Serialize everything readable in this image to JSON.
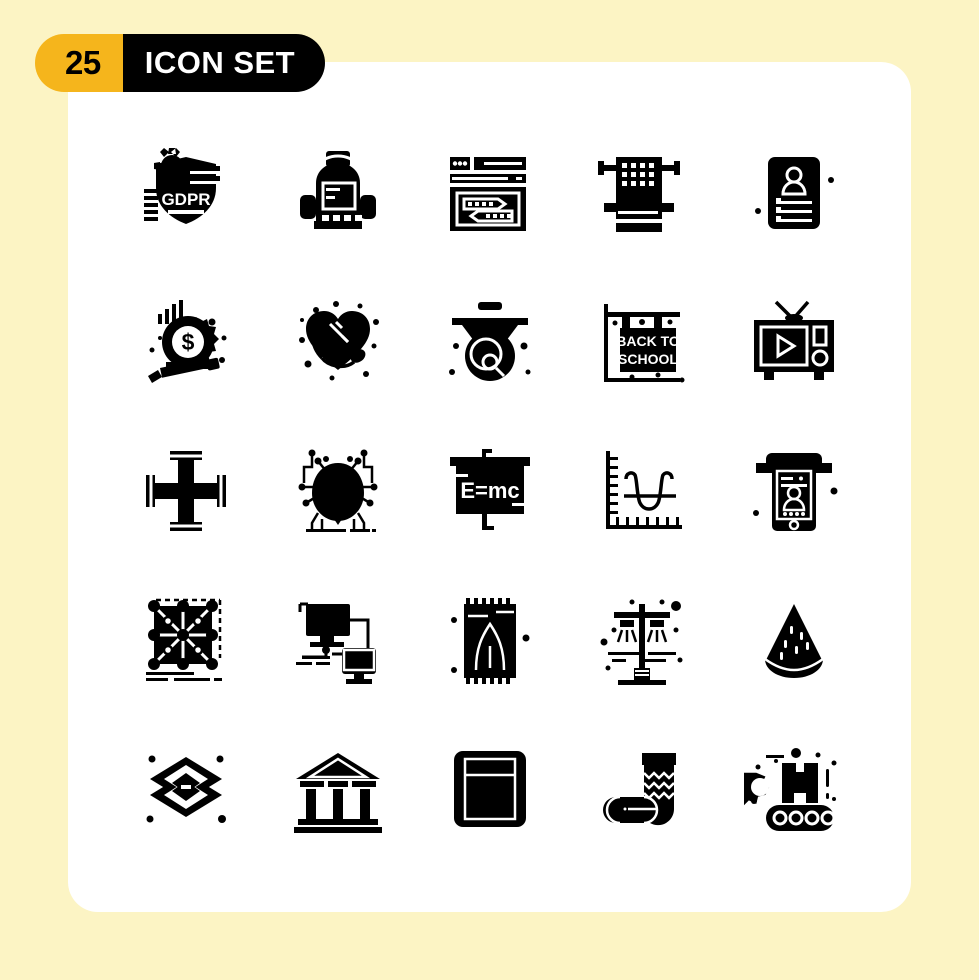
{
  "header": {
    "count": "25",
    "title": "ICON SET"
  },
  "colors": {
    "background": "#FCF4C4",
    "card": "#FFFFFF",
    "badge_count_bg": "#F5B51C",
    "badge_title_bg": "#000000",
    "icon": "#000000"
  },
  "grid": {
    "columns": 5,
    "rows": 5,
    "total": 25
  },
  "icons": [
    {
      "index": 1,
      "name": "gdpr-shield-icon",
      "label": "GDPR",
      "row": 1,
      "col": 1
    },
    {
      "index": 2,
      "name": "backpack-icon",
      "label": "",
      "row": 1,
      "col": 2
    },
    {
      "index": 3,
      "name": "browser-chat-window-icon",
      "label": "",
      "row": 1,
      "col": 3
    },
    {
      "index": 4,
      "name": "microchip-processor-icon",
      "label": "",
      "row": 1,
      "col": 4
    },
    {
      "index": 5,
      "name": "resume-profile-card-icon",
      "label": "",
      "row": 1,
      "col": 5
    },
    {
      "index": 6,
      "name": "content-monetization-pencil-icon",
      "label": "",
      "row": 2,
      "col": 1
    },
    {
      "index": 7,
      "name": "heart-stethoscope-icon",
      "label": "",
      "row": 2,
      "col": 2
    },
    {
      "index": 8,
      "name": "graduation-cap-search-icon",
      "label": "",
      "row": 2,
      "col": 3
    },
    {
      "index": 9,
      "name": "back-to-school-sign-icon",
      "label": "BACK TO SCHOOL",
      "row": 2,
      "col": 4
    },
    {
      "index": 10,
      "name": "retro-television-play-icon",
      "label": "",
      "row": 2,
      "col": 5
    },
    {
      "index": 11,
      "name": "lug-wrench-cross-icon",
      "label": "",
      "row": 3,
      "col": 1
    },
    {
      "index": 12,
      "name": "cyber-bug-malware-icon",
      "label": "",
      "row": 3,
      "col": 2
    },
    {
      "index": 13,
      "name": "physics-board-formula-icon",
      "label": "E=mc",
      "row": 3,
      "col": 3
    },
    {
      "index": 14,
      "name": "u-curve-graph-icon",
      "label": "",
      "row": 3,
      "col": 4
    },
    {
      "index": 15,
      "name": "mobile-user-login-icon",
      "label": "",
      "row": 3,
      "col": 5
    },
    {
      "index": 16,
      "name": "network-grid-nodes-icon",
      "label": "",
      "row": 4,
      "col": 1
    },
    {
      "index": 17,
      "name": "connected-computers-icon",
      "label": "",
      "row": 4,
      "col": 2
    },
    {
      "index": 18,
      "name": "prayer-rug-icon",
      "label": "",
      "row": 4,
      "col": 3
    },
    {
      "index": 19,
      "name": "street-lamp-icon",
      "label": "",
      "row": 4,
      "col": 4
    },
    {
      "index": 20,
      "name": "watermelon-slice-icon",
      "label": "",
      "row": 4,
      "col": 5
    },
    {
      "index": 21,
      "name": "layers-stack-icon",
      "label": "",
      "row": 5,
      "col": 1
    },
    {
      "index": 22,
      "name": "bank-building-icon",
      "label": "",
      "row": 5,
      "col": 2
    },
    {
      "index": 23,
      "name": "book-notebook-icon",
      "label": "",
      "row": 5,
      "col": 3
    },
    {
      "index": 24,
      "name": "sock-icon",
      "label": "",
      "row": 5,
      "col": 4
    },
    {
      "index": 25,
      "name": "conveyor-belt-box-icon",
      "label": "",
      "row": 5,
      "col": 5
    }
  ]
}
